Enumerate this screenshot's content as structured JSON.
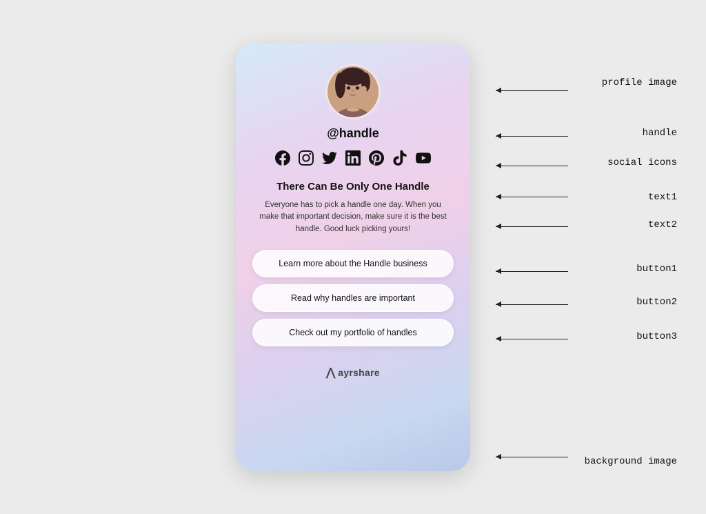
{
  "page": {
    "background": "#ebebeb"
  },
  "card": {
    "gradient_start": "#d4eaf7",
    "gradient_end": "#b8c8e8"
  },
  "profile": {
    "handle": "@handle",
    "image_alt": "profile image of a woman"
  },
  "social_icons": {
    "items": [
      {
        "name": "facebook-icon",
        "symbol": "f",
        "unicode": "𝐟"
      },
      {
        "name": "instagram-icon",
        "symbol": "📷"
      },
      {
        "name": "twitter-icon",
        "symbol": "🐦"
      },
      {
        "name": "linkedin-icon",
        "symbol": "in"
      },
      {
        "name": "pinterest-icon",
        "symbol": "𝐏"
      },
      {
        "name": "tiktok-icon",
        "symbol": "♪"
      },
      {
        "name": "youtube-icon",
        "symbol": "▶"
      }
    ]
  },
  "text1": "There Can Be Only One Handle",
  "text2": "Everyone has to pick a handle one day. When you make that important decision, make sure it is the best handle. Good luck picking yours!",
  "buttons": {
    "button1": "Learn more about the Handle business",
    "button2": "Read why handles are important",
    "button3": "Check out my portfolio of handles"
  },
  "branding": {
    "logo_symbol": "⋀",
    "name": "ayrshare"
  },
  "annotations": {
    "profile_image": "profile image",
    "handle": "handle",
    "social_icons": "social icons",
    "text1": "text1",
    "text2": "text2",
    "button1": "button1",
    "button2": "button2",
    "button3": "button3",
    "background": "background image"
  }
}
